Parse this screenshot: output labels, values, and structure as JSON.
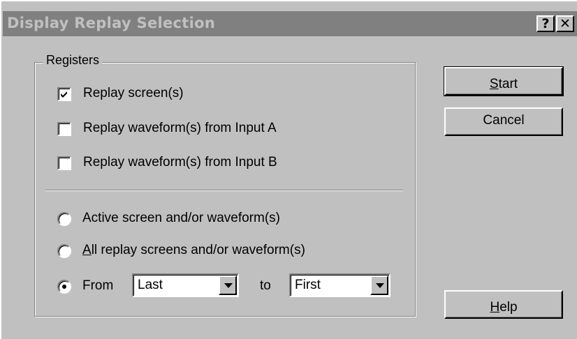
{
  "dialog": {
    "title": "Display Replay Selection",
    "help_glyph": "?",
    "close_glyph": "✕"
  },
  "registers": {
    "group_label": "Registers",
    "checkboxes": [
      {
        "label": "Replay screen(s)",
        "checked": true
      },
      {
        "label": "Replay waveform(s) from Input A",
        "checked": false
      },
      {
        "label": "Replay waveform(s) from Input B",
        "checked": false
      }
    ],
    "radios": [
      {
        "label": "Active screen and/or waveform(s)",
        "selected": false
      },
      {
        "label_accel": "A",
        "label_rest": "ll replay screens and/or waveform(s)",
        "selected": false
      },
      {
        "label": "From",
        "selected": true
      }
    ],
    "from_select": {
      "value": "Last"
    },
    "to_label": "to",
    "to_select": {
      "value": "First"
    }
  },
  "buttons": {
    "start_accel": "S",
    "start_rest": "tart",
    "cancel": "Cancel",
    "help_accel": "H",
    "help_rest": "elp"
  }
}
